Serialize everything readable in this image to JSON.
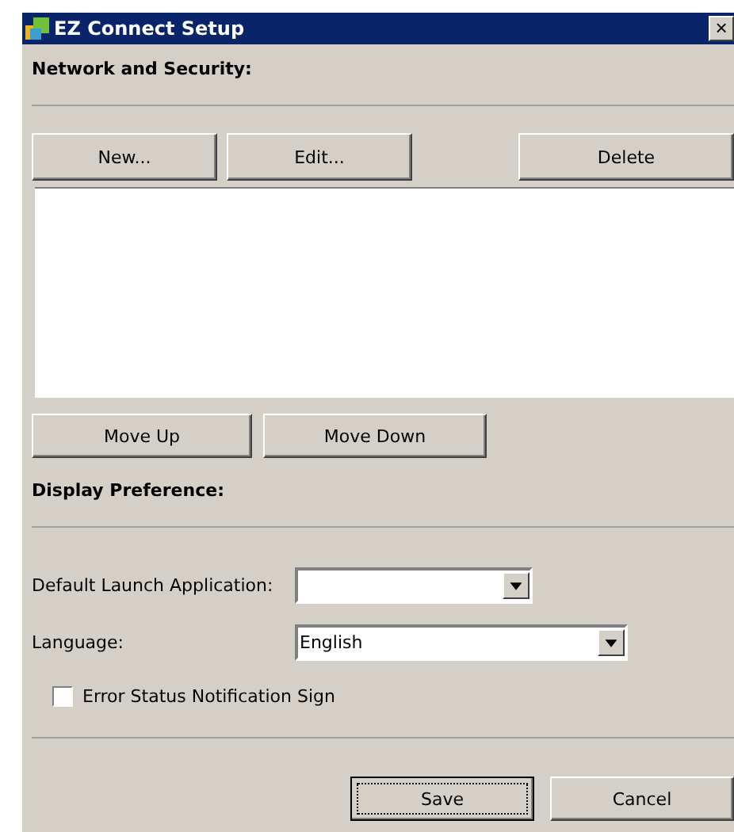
{
  "window": {
    "title": "EZ Connect Setup",
    "close": "×"
  },
  "network_section": {
    "heading": "Network and Security:",
    "buttons": [
      {
        "label": "New..."
      },
      {
        "label": "Edit..."
      },
      {
        "label": "Delete"
      }
    ],
    "move_buttons": [
      {
        "label": "Move Up"
      },
      {
        "label": "Move Down"
      }
    ]
  },
  "display_section": {
    "heading": "Display Preference:",
    "default_launch": {
      "label": "Default Launch Application:"
    },
    "language": {
      "label": "Language:",
      "value": "English"
    },
    "error_sign": {
      "label": "Error Status Notification Sign",
      "checked": false
    }
  },
  "footer_buttons": [
    {
      "label": "Save",
      "focused": true
    },
    {
      "label": "Cancel",
      "focused": false
    }
  ]
}
